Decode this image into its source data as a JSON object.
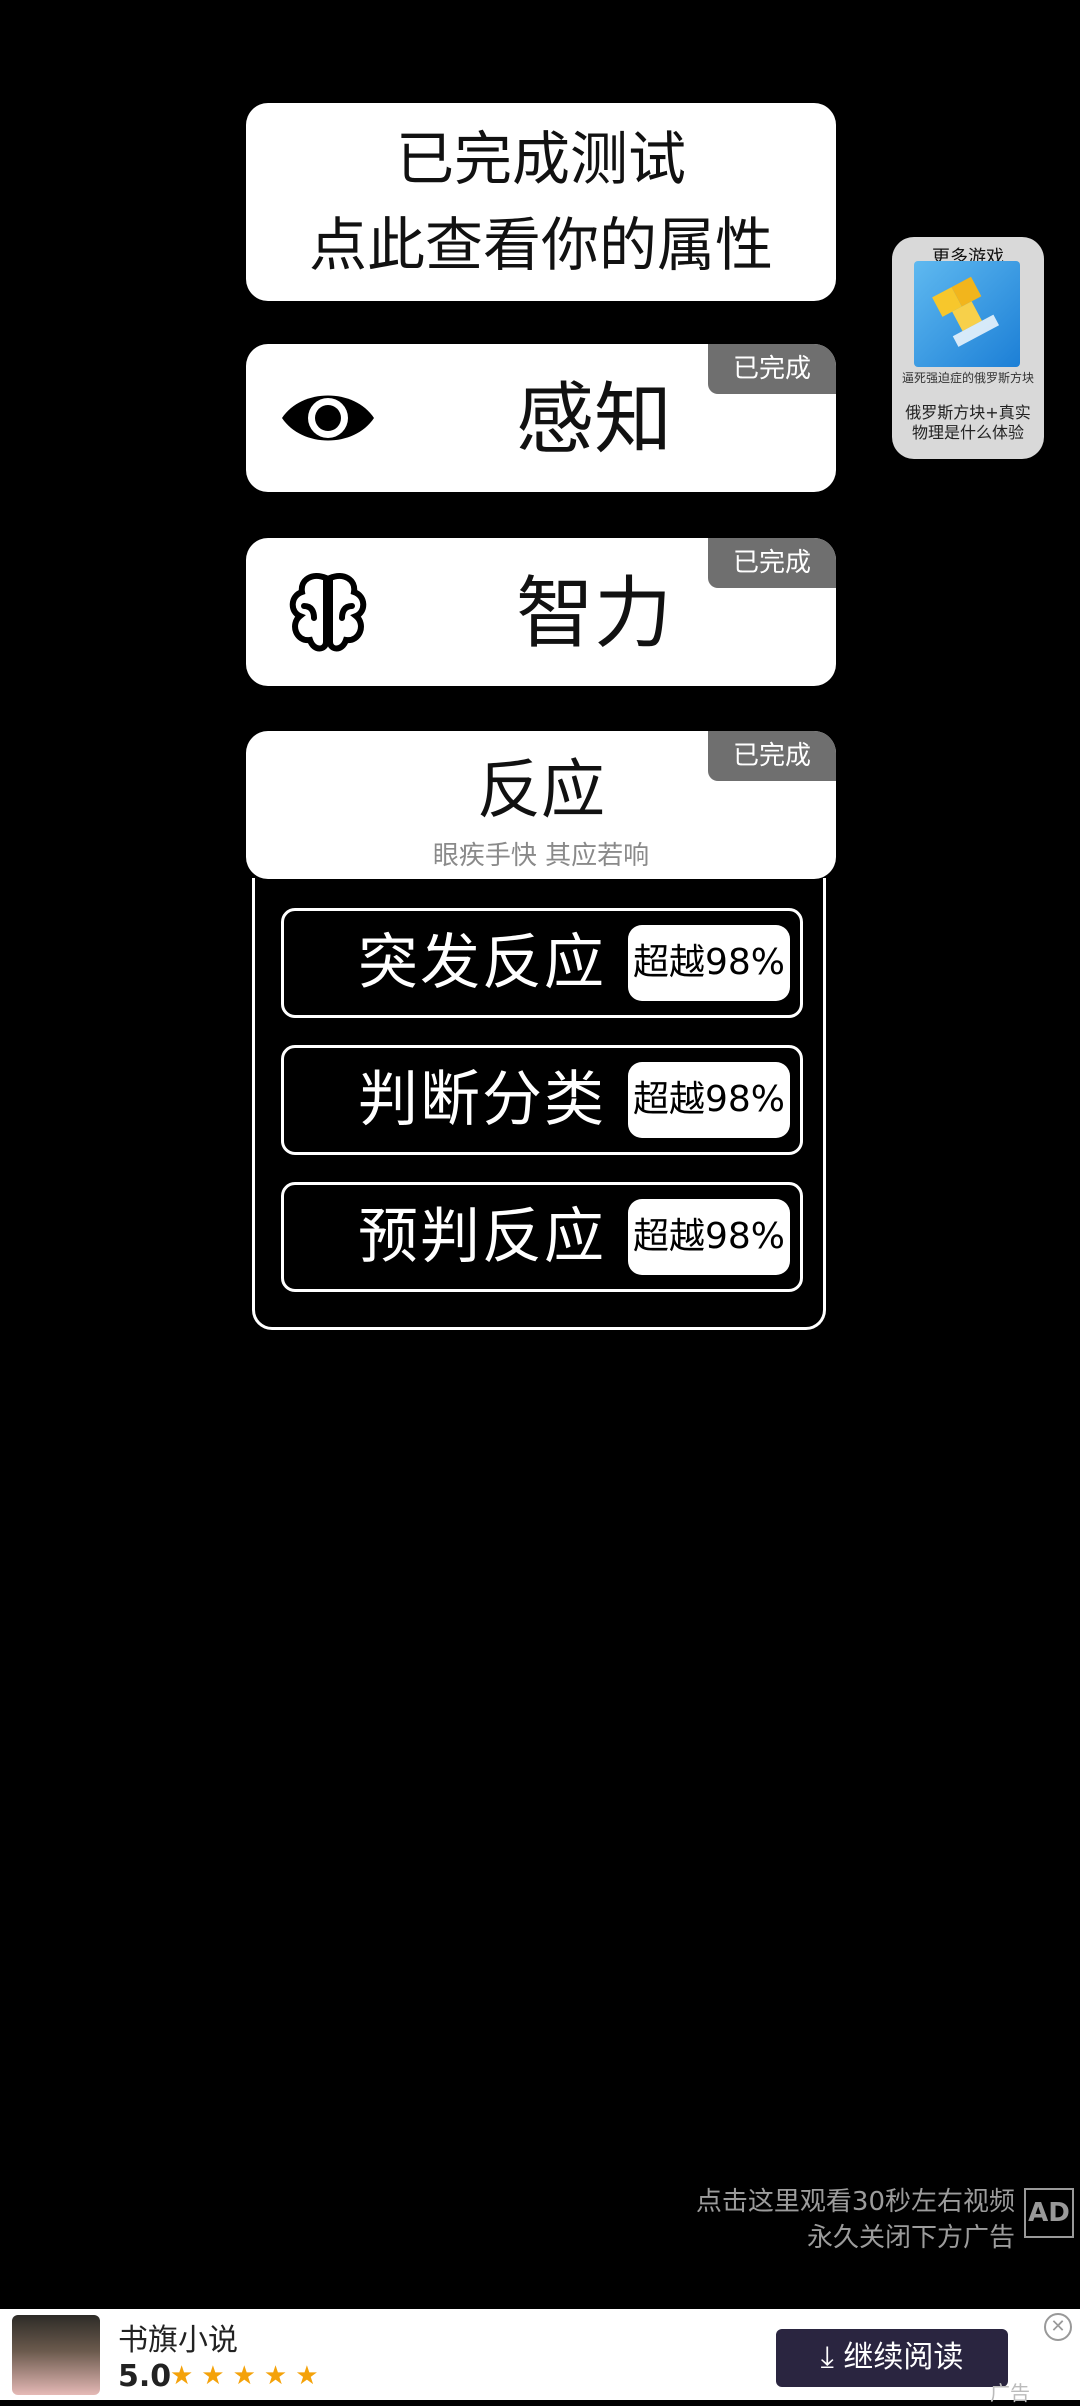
{
  "summary": {
    "line1": "已完成测试",
    "line2": "点此查看你的属性"
  },
  "done_label": "已完成",
  "attributes": [
    {
      "title": "感知",
      "icon": "eye-icon"
    },
    {
      "title": "智力",
      "icon": "brain-icon"
    }
  ],
  "reaction": {
    "title": "反应",
    "subtitle": "眼疾手快 其应若响",
    "items": [
      {
        "label": "突发反应",
        "badge": "超越98%"
      },
      {
        "label": "判断分类",
        "badge": "超越98%"
      },
      {
        "label": "预判反应",
        "badge": "超越98%"
      }
    ]
  },
  "side_ad": {
    "header": "更多游戏",
    "caption": "逼死强迫症的俄罗斯方块",
    "description": "俄罗斯方块+真实物理是什么体验"
  },
  "video_hint": {
    "line1": "点击这里观看30秒左右视频",
    "line2": "永久关闭下方广告",
    "ad_icon_text": "AD"
  },
  "banner": {
    "app_name": "书旗小说",
    "rating": "5.0",
    "stars": "★★★★★",
    "cta": "⤓ 继续阅读",
    "close": "✕",
    "ad_label": "广告"
  },
  "colors": {
    "background": "#000000",
    "card": "#ffffff",
    "done_tag": "#6f6f6f",
    "cta": "#2a2540",
    "star": "#f4a20a"
  }
}
